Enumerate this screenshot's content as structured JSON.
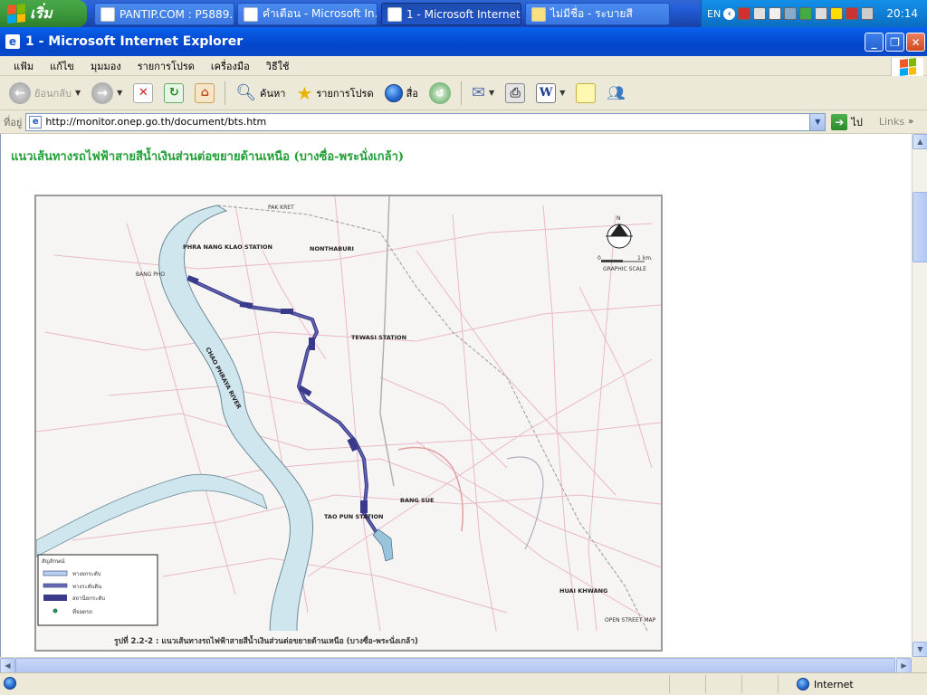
{
  "taskbar": {
    "start_label": "เริ่ม",
    "tasks": [
      {
        "label": "PANTIP.COM : P5889...",
        "active": false
      },
      {
        "label": "คำเตือน - Microsoft In...",
        "active": false
      },
      {
        "label": "1 - Microsoft Internet...",
        "active": true
      },
      {
        "label": "ไม่มีชื่อ - ระบายสี",
        "active": false
      }
    ],
    "language": "EN",
    "clock": "20:14"
  },
  "window": {
    "title": "1 - Microsoft Internet Explorer",
    "menu": [
      "แฟ้ม",
      "แก้ไข",
      "มุมมอง",
      "รายการโปรด",
      "เครื่องมือ",
      "วิธีใช้"
    ],
    "toolbar": {
      "back_label": "ย้อนกลับ",
      "search_label": "ค้นหา",
      "favorites_label": "รายการโปรด",
      "media_label": "สื่อ",
      "word_label": "W"
    },
    "address": {
      "label": "ที่อยู่",
      "url": "http://monitor.onep.go.th/document/bts.htm",
      "go_label": "ไป",
      "links_label": "Links"
    },
    "status": {
      "zone": "Internet"
    }
  },
  "page": {
    "heading": "แนวเส้นทางรถไฟฟ้าสายสีน้ำเงินส่วนต่อขยายด้านเหนือ (บางซื่อ-พระนั่งเกล้า)",
    "map": {
      "caption": "รูปที่ 2.2-2 : แนวเส้นทางรถไฟฟ้าสายสีน้ำเงินส่วนต่อขยายด้านเหนือ (บางซื่อ-พระนั่งเกล้า)",
      "labels": {
        "phra_nang_klao": "PHRA NANG KLAO STATION",
        "nonthaburi": "NONTHABURI",
        "tewasi": "TEWASI STATION",
        "bang_sue": "BANG SUE",
        "tao_pun": "TAO PUN STATION",
        "bang_pho": "BANG PHO",
        "pak_kret": "PAK KRET",
        "river": "CHAO PHRAYA RIVER",
        "huai_khwang": "HUAI KHWANG",
        "graphic_scale": "GRAPHIC SCALE",
        "north": "N",
        "scale_zero": "0",
        "scale_one": "1 km.",
        "credit": "OPEN STREET MAP"
      },
      "legend": {
        "title": "สัญลักษณ์",
        "items": [
          "ทางยกระดับ",
          "ทางระดับดิน",
          "สถานียกระดับ",
          "ที่จอดรถ"
        ]
      }
    }
  }
}
